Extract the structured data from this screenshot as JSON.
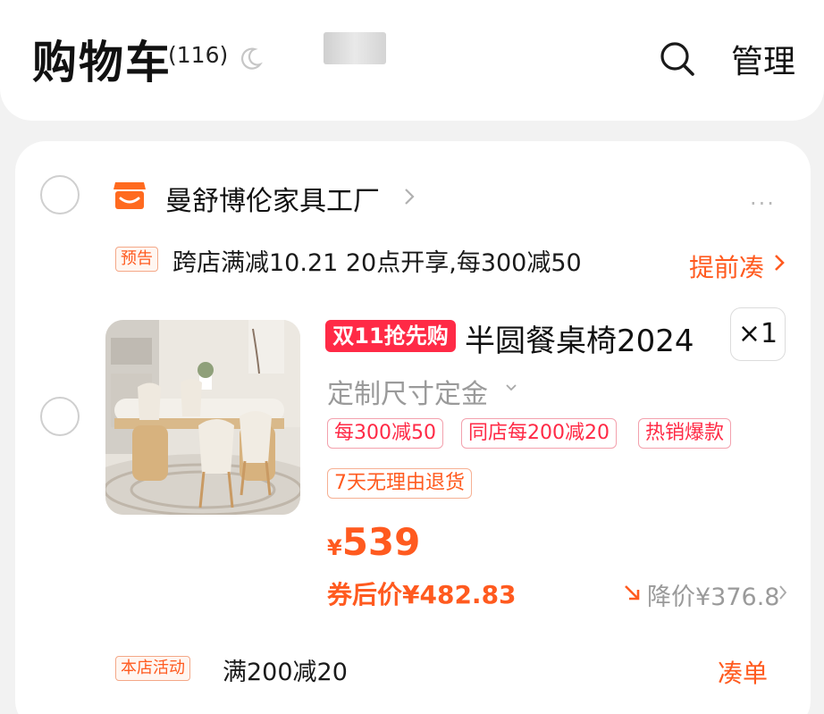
{
  "header": {
    "title": "购物车",
    "count": "(116)",
    "manage_label": "管理"
  },
  "shop": {
    "name": "曼舒博伦家具工厂",
    "more": "···",
    "promo_tag": "预告",
    "promo_text": "跨店满减10.21 20点开享,每300减50",
    "topup_label": "提前凑"
  },
  "product": {
    "event_badge": "双11抢先购",
    "name": "半圆餐桌椅2024",
    "quantity": "×1",
    "spec": "定制尺寸定金",
    "tags": [
      "每300减50",
      "同店每200减20",
      "热销爆款"
    ],
    "return_tag": "7天无理由退货",
    "currency": "¥",
    "price": "539",
    "after_coupon_price": "券后价¥482.83",
    "price_drop": "降价¥376.8"
  },
  "store_activity": {
    "tag": "本店活动",
    "text": "满200减20",
    "checkout_label": "凑单"
  },
  "colors": {
    "accent_orange": "#ff5a1f",
    "accent_red": "#ff2a46",
    "background": "#f2f2f2"
  }
}
